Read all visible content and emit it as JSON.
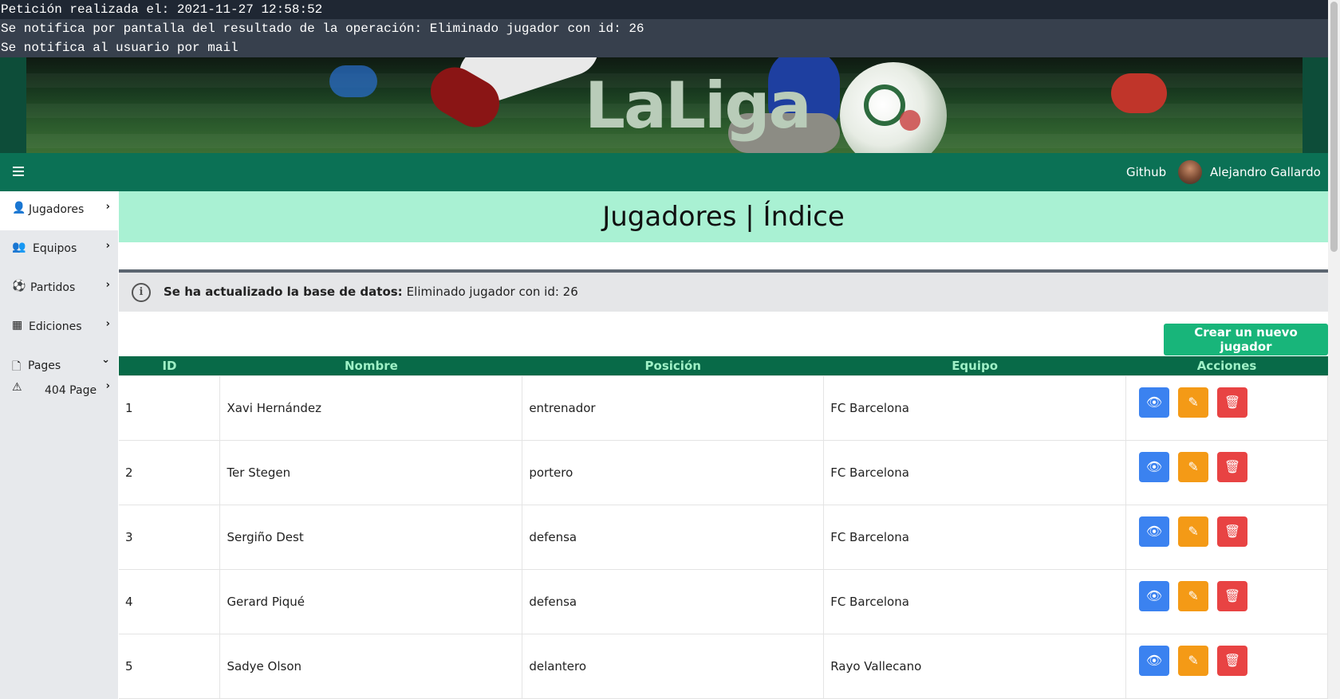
{
  "debug": {
    "lines": [
      "Petición realizada el: 2021-11-27 12:58:52",
      "Se notifica por pantalla del resultado de la operación: Eliminado jugador con id: 26",
      "Se notifica al usuario por mail"
    ]
  },
  "banner": {
    "title": "LaLiga"
  },
  "navbar": {
    "menu_icon": "hamburger-icon",
    "github_label": "Github",
    "user_name": "Alejandro Gallardo"
  },
  "sidebar": {
    "items": [
      {
        "label": "Jugadores",
        "icon": "user-icon",
        "glyph": "👤",
        "chevron": "›",
        "active": true
      },
      {
        "label": "Equipos",
        "icon": "users-icon",
        "glyph": "👥",
        "chevron": "›"
      },
      {
        "label": "Partidos",
        "icon": "futbol-icon",
        "glyph": "⚽",
        "chevron": "›"
      },
      {
        "label": "Ediciones",
        "icon": "calendar-icon",
        "glyph": "▦",
        "chevron": "›"
      },
      {
        "label": "Pages",
        "icon": "file-icon",
        "glyph": "🗋",
        "chevron": "⌄"
      },
      {
        "label": "404 Page",
        "icon": "warning-icon",
        "glyph": "⚠",
        "chevron": "›"
      }
    ]
  },
  "page": {
    "title": "Jugadores | Índice"
  },
  "alert": {
    "icon": "info-icon",
    "bold": "Se ha actualizado la base de datos:",
    "text": "Eliminado jugador con id: 26"
  },
  "create_button": "Crear un nuevo jugador",
  "table": {
    "headers": [
      "ID",
      "Nombre",
      "Posición",
      "Equipo",
      "Acciones"
    ],
    "rows": [
      {
        "id": "1",
        "nombre": "Xavi Hernández",
        "posicion": "entrenador",
        "equipo": "FC Barcelona"
      },
      {
        "id": "2",
        "nombre": "Ter Stegen",
        "posicion": "portero",
        "equipo": "FC Barcelona"
      },
      {
        "id": "3",
        "nombre": "Sergiño Dest",
        "posicion": "defensa",
        "equipo": "FC Barcelona"
      },
      {
        "id": "4",
        "nombre": "Gerard Piqué",
        "posicion": "defensa",
        "equipo": "FC Barcelona"
      },
      {
        "id": "5",
        "nombre": "Sadye Olson",
        "posicion": "delantero",
        "equipo": "Rayo Vallecano"
      }
    ],
    "action_icons": [
      "eye-icon",
      "edit-icon",
      "trash-icon"
    ]
  },
  "colors": {
    "navbar": "#0b7155",
    "header_band": "#a9f1d3",
    "table_header": "#086a48",
    "create_button": "#18b57a",
    "view_button": "#3b82f0",
    "edit_button": "#f49a16",
    "delete_button": "#e84343"
  }
}
